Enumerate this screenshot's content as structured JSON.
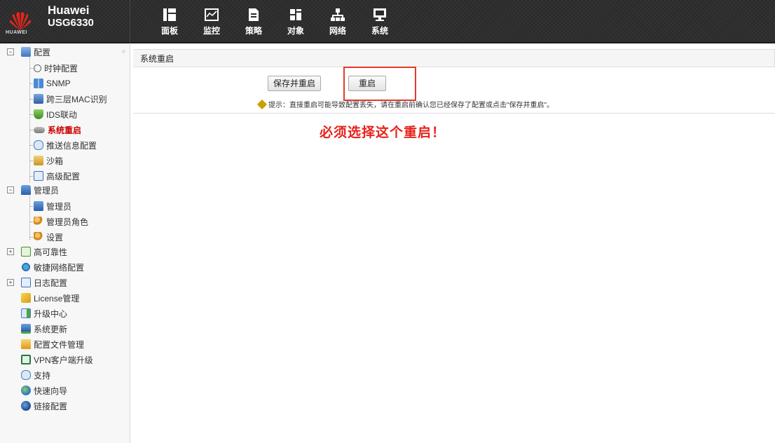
{
  "header": {
    "logo_text": "HUAWEI",
    "brand_name": "Huawei",
    "model": "USG6330",
    "nav": [
      {
        "label": "面板",
        "icon": "dashboard-icon"
      },
      {
        "label": "监控",
        "icon": "monitor-icon"
      },
      {
        "label": "策略",
        "icon": "policy-icon"
      },
      {
        "label": "对象",
        "icon": "object-icon"
      },
      {
        "label": "网络",
        "icon": "network-icon"
      },
      {
        "label": "系统",
        "icon": "system-icon"
      }
    ]
  },
  "sidebar": {
    "groups": [
      {
        "label": "配置",
        "toggle": "−",
        "children": [
          "时钟配置",
          "SNMP",
          "跨三层MAC识别",
          "IDS联动",
          "系统重启",
          "推送信息配置",
          "沙箱",
          "高级配置"
        ]
      },
      {
        "label": "管理员",
        "toggle": "−",
        "children": [
          "管理员",
          "管理员角色",
          "设置"
        ]
      },
      {
        "label": "高可靠性",
        "toggle": "+"
      },
      {
        "label": "敏捷网络配置"
      },
      {
        "label": "日志配置",
        "toggle": "+"
      },
      {
        "label": "License管理"
      },
      {
        "label": "升级中心"
      },
      {
        "label": "系统更新"
      },
      {
        "label": "配置文件管理"
      },
      {
        "label": "VPN客户端升级"
      },
      {
        "label": "支持"
      },
      {
        "label": "快速向导"
      },
      {
        "label": "链接配置"
      }
    ],
    "active_item": "系统重启"
  },
  "main": {
    "panel_title": "系统重启",
    "save_and_restart_label": "保存并重启",
    "restart_label": "重启",
    "hint": "提示：直接重启可能导致配置丢失，请在重启前确认您已经保存了配置或点击\"保存并重启\"。"
  },
  "annotation": {
    "text": "必须选择这个重启！",
    "color": "#e8221b"
  },
  "colors": {
    "header_bg": "#2b2b2b",
    "active_item": "#cc0000",
    "annotation_box": "#e23a2a"
  }
}
